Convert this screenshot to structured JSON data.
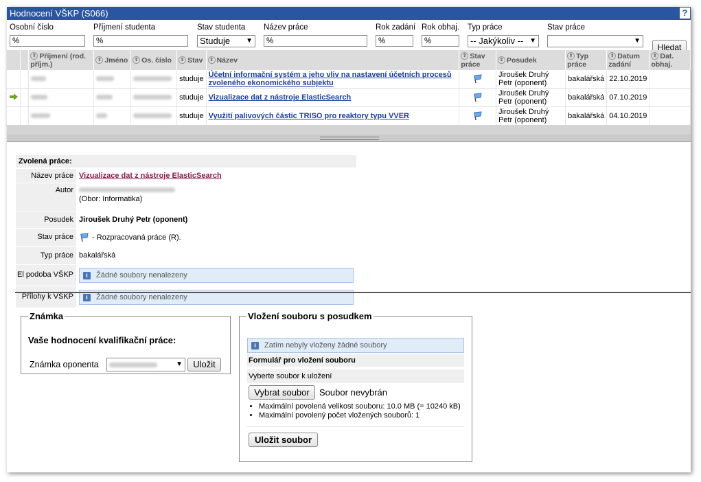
{
  "window": {
    "title": "Hodnocení VŠKP (S066)",
    "help": "?"
  },
  "filters": {
    "osobni_cislo": {
      "label": "Osobní číslo",
      "value": "%"
    },
    "prijmeni": {
      "label": "Příjmení studenta",
      "value": "%"
    },
    "stav_studenta": {
      "label": "Stav studenta",
      "value": "Studuje"
    },
    "nazev_prace": {
      "label": "Název práce",
      "value": "%"
    },
    "rok_zadani": {
      "label": "Rok zadání",
      "value": "%"
    },
    "rok_obhaj": {
      "label": "Rok obhaj.",
      "value": "%"
    },
    "typ_prace": {
      "label": "Typ práce",
      "value": "-- Jakýkoliv --"
    },
    "stav_prace": {
      "label": "Stav práce",
      "value": ""
    },
    "search_button": "Hledat"
  },
  "table": {
    "headers": {
      "prijmeni": "Příjmení (rod. příjm.)",
      "jmeno": "Jméno",
      "os_cislo": "Os. číslo",
      "stav": "Stav",
      "nazev": "Název",
      "stav_prace": "Stav práce",
      "posudek": "Posudek",
      "typ_prace": "Typ práce",
      "datum_zadani": "Datum zadání",
      "dat_obhaj": "Dat. obhaj."
    },
    "rows": [
      {
        "stav": "studuje",
        "nazev": "Účetní informační systém a jeho vliv na nastavení účetních procesů zvoleného ekonomického subjektu",
        "posudek": "Jiroušek Druhý Petr (oponent)",
        "typ": "bakalářská",
        "datum": "22.10.2019",
        "selected": false
      },
      {
        "stav": "studuje",
        "nazev": "Vizualizace dat z nástroje ElasticSearch",
        "posudek": "Jiroušek Druhý Petr (oponent)",
        "typ": "bakalářská",
        "datum": "07.10.2019",
        "selected": true
      },
      {
        "stav": "studuje",
        "nazev": "Využití palivových částic TRISO pro reaktory typu VVER",
        "posudek": "Jiroušek Druhý Petr (oponent)",
        "typ": "bakalářská",
        "datum": "04.10.2019",
        "selected": false
      }
    ]
  },
  "detail": {
    "heading": "Zvolená práce:",
    "nazev_label": "Název práce",
    "nazev_value": "Vizualizace dat z nástroje ElasticSearch",
    "autor_label": "Autor",
    "autor_obor": "(Obor: Informatika)",
    "posudek_label": "Posudek",
    "posudek_value": "Jiroušek Druhý Petr (oponent)",
    "stav_label": "Stav práce",
    "stav_value": "- Rozpracovaná práce (R).",
    "typ_label": "Typ práce",
    "typ_value": "bakalářská",
    "el_label": "El podoba VŠKP",
    "el_value": "Žádné soubory nenalezeny",
    "prilohy_label": "Přílohy k VŠKP",
    "prilohy_value": "Žádné soubory nenalezeny"
  },
  "znamka": {
    "legend": "Známka",
    "heading": "Vaše hodnocení kvalifikační práce:",
    "label": "Známka oponenta",
    "button": "Uložit"
  },
  "upload": {
    "legend": "Vložení souboru s posudkem",
    "info": "Zatím nebyly vloženy žádné soubory",
    "form_title": "Formulář pro vložení souboru",
    "choose_label": "Vyberte soubor k uložení",
    "choose_button": "Vybrat soubor",
    "no_file": "Soubor nevybrán",
    "limit1": "Maximální povolená velikost souboru: 10.0 MB (= 10240 kB)",
    "limit2": "Maximální povolený počet vložených souborů: 1",
    "save_button": "Uložit soubor"
  },
  "colors": {
    "titlebar": "#2a55a0",
    "link": "#1a3e9c",
    "link_selected": "#8b1a4a",
    "info_bg": "#e1ecf9"
  }
}
